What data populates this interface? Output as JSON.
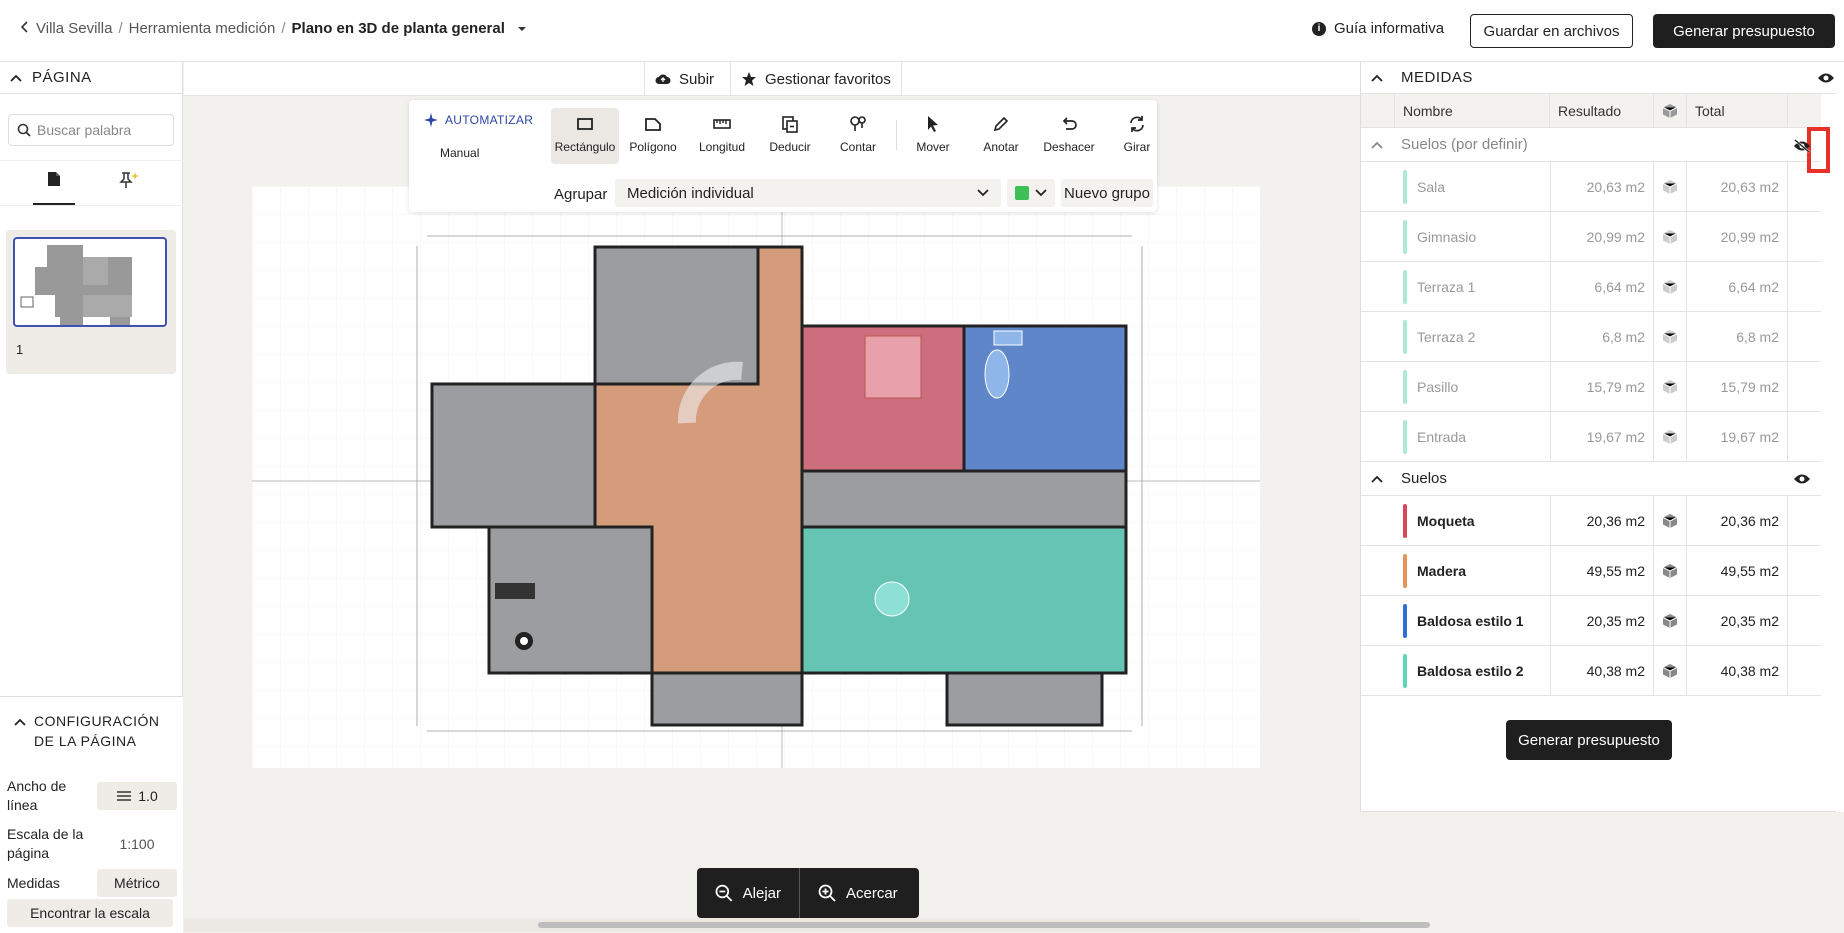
{
  "header": {
    "breadcrumb": [
      "Villa Sevilla",
      "Herramienta medición",
      "Plano en 3D de planta general"
    ],
    "guide_label": "Guía informativa",
    "save_label": "Guardar en archivos",
    "generate_label": "Generar presupuesto"
  },
  "left_panel": {
    "title": "PÁGINA",
    "search_placeholder": "Buscar palabra",
    "page_number": "1",
    "config_title": "CONFIGURACIÓN DE LA PÁGINA",
    "line_width_label": "Ancho de línea",
    "line_width_value": "1.0",
    "scale_label": "Escala de la página",
    "scale_value": "1:100",
    "units_label": "Medidas",
    "units_value": "Métrico",
    "find_scale_label": "Encontrar la escala"
  },
  "toolbar": {
    "upload_label": "Subir",
    "favorites_label": "Gestionar favoritos",
    "automate_label": "AUTOMATIZAR",
    "manual_label": "Manual",
    "tools": [
      "Rectángulo",
      "Polígono",
      "Longitud",
      "Deducir",
      "Contar",
      "Mover",
      "Anotar",
      "Deshacer",
      "Girar"
    ],
    "group_label": "Agrupar",
    "group_value": "Medición individual",
    "new_group_label": "Nuevo grupo",
    "swatch_color": "#3fbf57"
  },
  "zoom": {
    "out_label": "Alejar",
    "in_label": "Acercar"
  },
  "measures": {
    "title": "MEDIDAS",
    "columns": [
      "Nombre",
      "Resultado",
      "Total"
    ],
    "groups": [
      {
        "name": "Suelos (por definir)",
        "rows": [
          {
            "name": "Sala",
            "result": "20,63 m2",
            "total": "20,63 m2",
            "color": "#5cd6a6"
          },
          {
            "name": "Gimnasio",
            "result": "20,99 m2",
            "total": "20,99 m2",
            "color": "#5cd6a6"
          },
          {
            "name": "Terraza 1",
            "result": "6,64 m2",
            "total": "6,64 m2",
            "color": "#5cd6a6"
          },
          {
            "name": "Terraza 2",
            "result": "6,8 m2",
            "total": "6,8 m2",
            "color": "#5cd6a6"
          },
          {
            "name": "Pasillo",
            "result": "15,79 m2",
            "total": "15,79 m2",
            "color": "#5cd6a6"
          },
          {
            "name": "Entrada",
            "result": "19,67 m2",
            "total": "19,67 m2",
            "color": "#5cd6a6"
          }
        ]
      },
      {
        "name": "Suelos",
        "rows": [
          {
            "name": "Moqueta",
            "result": "20,36 m2",
            "total": "20,36 m2",
            "color": "#d9475b"
          },
          {
            "name": "Madera",
            "result": "49,55 m2",
            "total": "49,55 m2",
            "color": "#e59558"
          },
          {
            "name": "Baldosa estilo 1",
            "result": "20,35 m2",
            "total": "20,35 m2",
            "color": "#2f6fd6"
          },
          {
            "name": "Baldosa estilo 2",
            "result": "40,38 m2",
            "total": "40,38 m2",
            "color": "#5cd6b8"
          }
        ]
      }
    ],
    "generate_label": "Generar presupuesto"
  }
}
